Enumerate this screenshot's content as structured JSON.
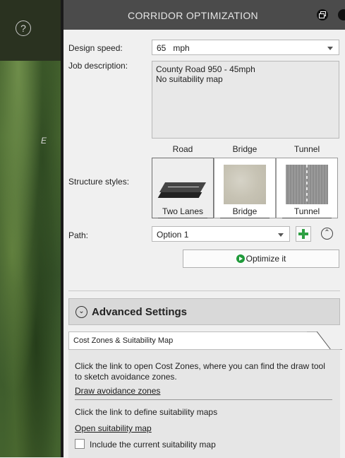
{
  "map": {
    "help_glyph": "?",
    "compass_letter": "E"
  },
  "panel": {
    "title": "CORRIDOR OPTIMIZATION",
    "design_speed_label": "Design speed:",
    "design_speed_value": "65   mph",
    "job_description_label": "Job description:",
    "job_description_lines": [
      "County Road 950 - 45mph",
      "No suitability map"
    ],
    "structure_styles_label": "Structure styles:",
    "structure_columns": [
      "Road",
      "Bridge",
      "Tunnel"
    ],
    "structure_tiles": [
      "Two Lanes",
      "Bridge",
      "Tunnel"
    ],
    "selected_structure": "Two Lanes",
    "path_label": "Path:",
    "path_value": "Option 1",
    "optimize_label": "Optimize it",
    "advanced_label": "Advanced Settings",
    "tab_label": "Cost Zones & Suitability Map",
    "cost_zones_text": "Click the link to open Cost Zones, where you can find the draw tool to sketch avoidance zones.",
    "draw_link": "Draw avoidance zones",
    "suitability_text": "Click the link to define suitability maps",
    "open_link": "Open suitability map",
    "include_label": "Include the current suitability map",
    "include_checked": false
  },
  "icons": {
    "help": "help-icon",
    "restore": "restore-icon",
    "close": "close-icon",
    "caret": "chevron-down-icon",
    "add": "plus-icon",
    "collapse": "chevron-up-double-icon",
    "advanced": "chevron-down-double-icon",
    "optimize": "optimize-icon"
  },
  "colors": {
    "titlebar": "#4b4b4b",
    "add_green": "#2ea043",
    "panel_bg": "#f0f0f0"
  }
}
